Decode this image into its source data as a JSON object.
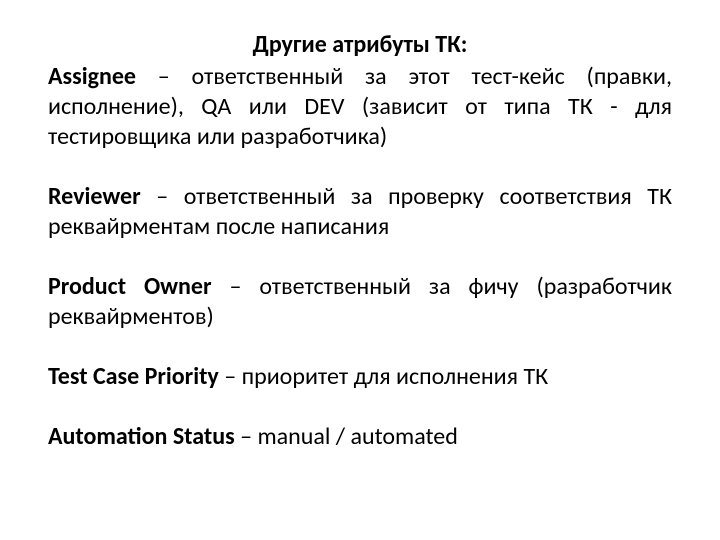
{
  "title": "Другие атрибуты ТК:",
  "entries": [
    {
      "term": "Assignee",
      "desc": " – ответственный за этот тест-кейс (правки, исполнение), QA или DEV (зависит от типа ТК - для тестировщика или разработчика)"
    },
    {
      "term": "Reviewer",
      "desc": " – ответственный за проверку соответствия ТК реквайрментам после написания"
    },
    {
      "term": "Product Owner",
      "desc": " – ответственный за фичу (разработчик реквайрментов)"
    },
    {
      "term": "Test Case Priority",
      "desc": " – приоритет для исполнения ТК"
    },
    {
      "term": "Automation Status",
      "desc": " – manual / automated"
    }
  ]
}
